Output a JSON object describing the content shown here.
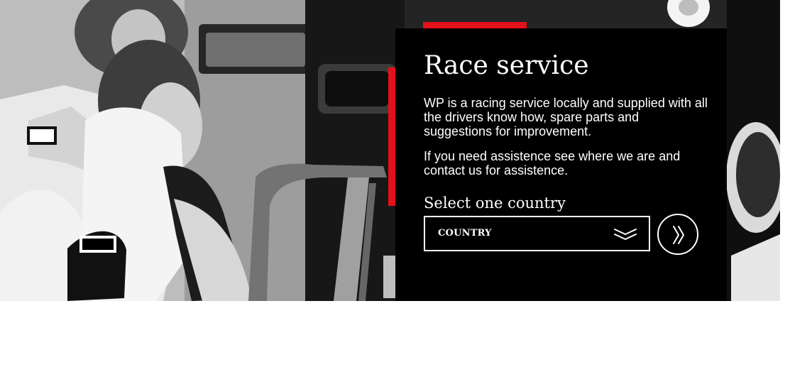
{
  "hero": {
    "image_description_icon": "race-mechanics-photo"
  },
  "panel": {
    "title": "Race service",
    "paragraph_1": "WP is a racing service locally and supplied with all the drivers know how, spare parts and suggestions for improvement.",
    "paragraph_2": "If you need assistence see where we are and contact us for assistence.",
    "select_label": "Select one country",
    "country_select": {
      "value": "COUNTRY",
      "icon": "double-chevron-down-icon"
    },
    "submit_button": {
      "icon": "double-chevron-right-icon"
    }
  },
  "colors": {
    "accent": "#e3111b",
    "panel_background": "#000000",
    "text": "#ffffff"
  }
}
